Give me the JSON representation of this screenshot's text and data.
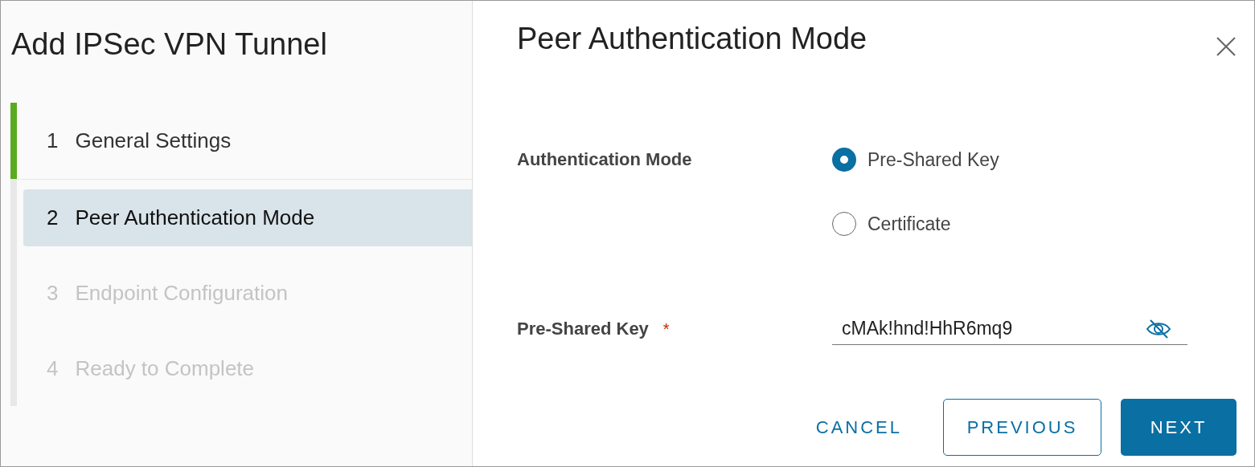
{
  "wizard": {
    "title": "Add IPSec VPN Tunnel",
    "steps": [
      {
        "number": "1",
        "label": "General Settings",
        "completed": true,
        "selected": false,
        "disabled": false
      },
      {
        "number": "2",
        "label": "Peer Authentication Mode",
        "completed": false,
        "selected": true,
        "disabled": false
      },
      {
        "number": "3",
        "label": "Endpoint Configuration",
        "completed": false,
        "selected": false,
        "disabled": true
      },
      {
        "number": "4",
        "label": "Ready to Complete",
        "completed": false,
        "selected": false,
        "disabled": true
      }
    ]
  },
  "page": {
    "title": "Peer Authentication Mode",
    "authentication_mode": {
      "label": "Authentication Mode",
      "options": [
        {
          "label": "Pre-Shared Key",
          "selected": true
        },
        {
          "label": "Certificate",
          "selected": false
        }
      ]
    },
    "pre_shared_key": {
      "label": "Pre-Shared Key",
      "required_mark": "*",
      "value": "cMAk!hnd!HhR6mq9"
    }
  },
  "buttons": [
    {
      "label": "CANCEL",
      "kind": "link"
    },
    {
      "label": "PREVIOUS",
      "kind": "outline"
    },
    {
      "label": "NEXT",
      "kind": "primary"
    }
  ]
}
